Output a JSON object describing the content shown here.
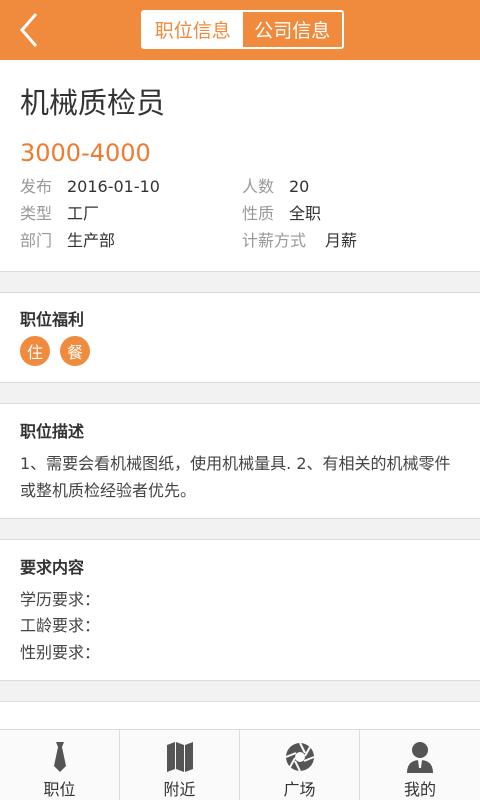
{
  "header": {
    "back_icon": "chevron-left-icon",
    "tabs": [
      {
        "label": "职位信息",
        "active": true
      },
      {
        "label": "公司信息",
        "active": false
      }
    ],
    "accent_color": "#f08a3c"
  },
  "job": {
    "title": "机械质检员",
    "salary": "3000-4000",
    "fields": {
      "publish_label": "发布",
      "publish_value": "2016-01-10",
      "count_label": "人数",
      "count_value": "20",
      "type_label": "类型",
      "type_value": "工厂",
      "nature_label": "性质",
      "nature_value": "全职",
      "dept_label": "部门",
      "dept_value": "生产部",
      "pay_label": "计薪方式",
      "pay_value": "月薪"
    }
  },
  "benefits": {
    "title": "职位福利",
    "items": [
      "住",
      "餐"
    ]
  },
  "description": {
    "title": "职位描述",
    "text": "1、需要会看机械图纸，使用机械量具. 2、有相关的机械零件或整机质检经验者优先。"
  },
  "requirements": {
    "title": "要求内容",
    "education": "学历要求：",
    "experience": "工龄要求：",
    "gender": "性别要求："
  },
  "tabbar": {
    "items": [
      {
        "label": "职位",
        "icon": "tie-icon"
      },
      {
        "label": "附近",
        "icon": "map-icon"
      },
      {
        "label": "广场",
        "icon": "aperture-icon"
      },
      {
        "label": "我的",
        "icon": "user-icon"
      }
    ]
  }
}
